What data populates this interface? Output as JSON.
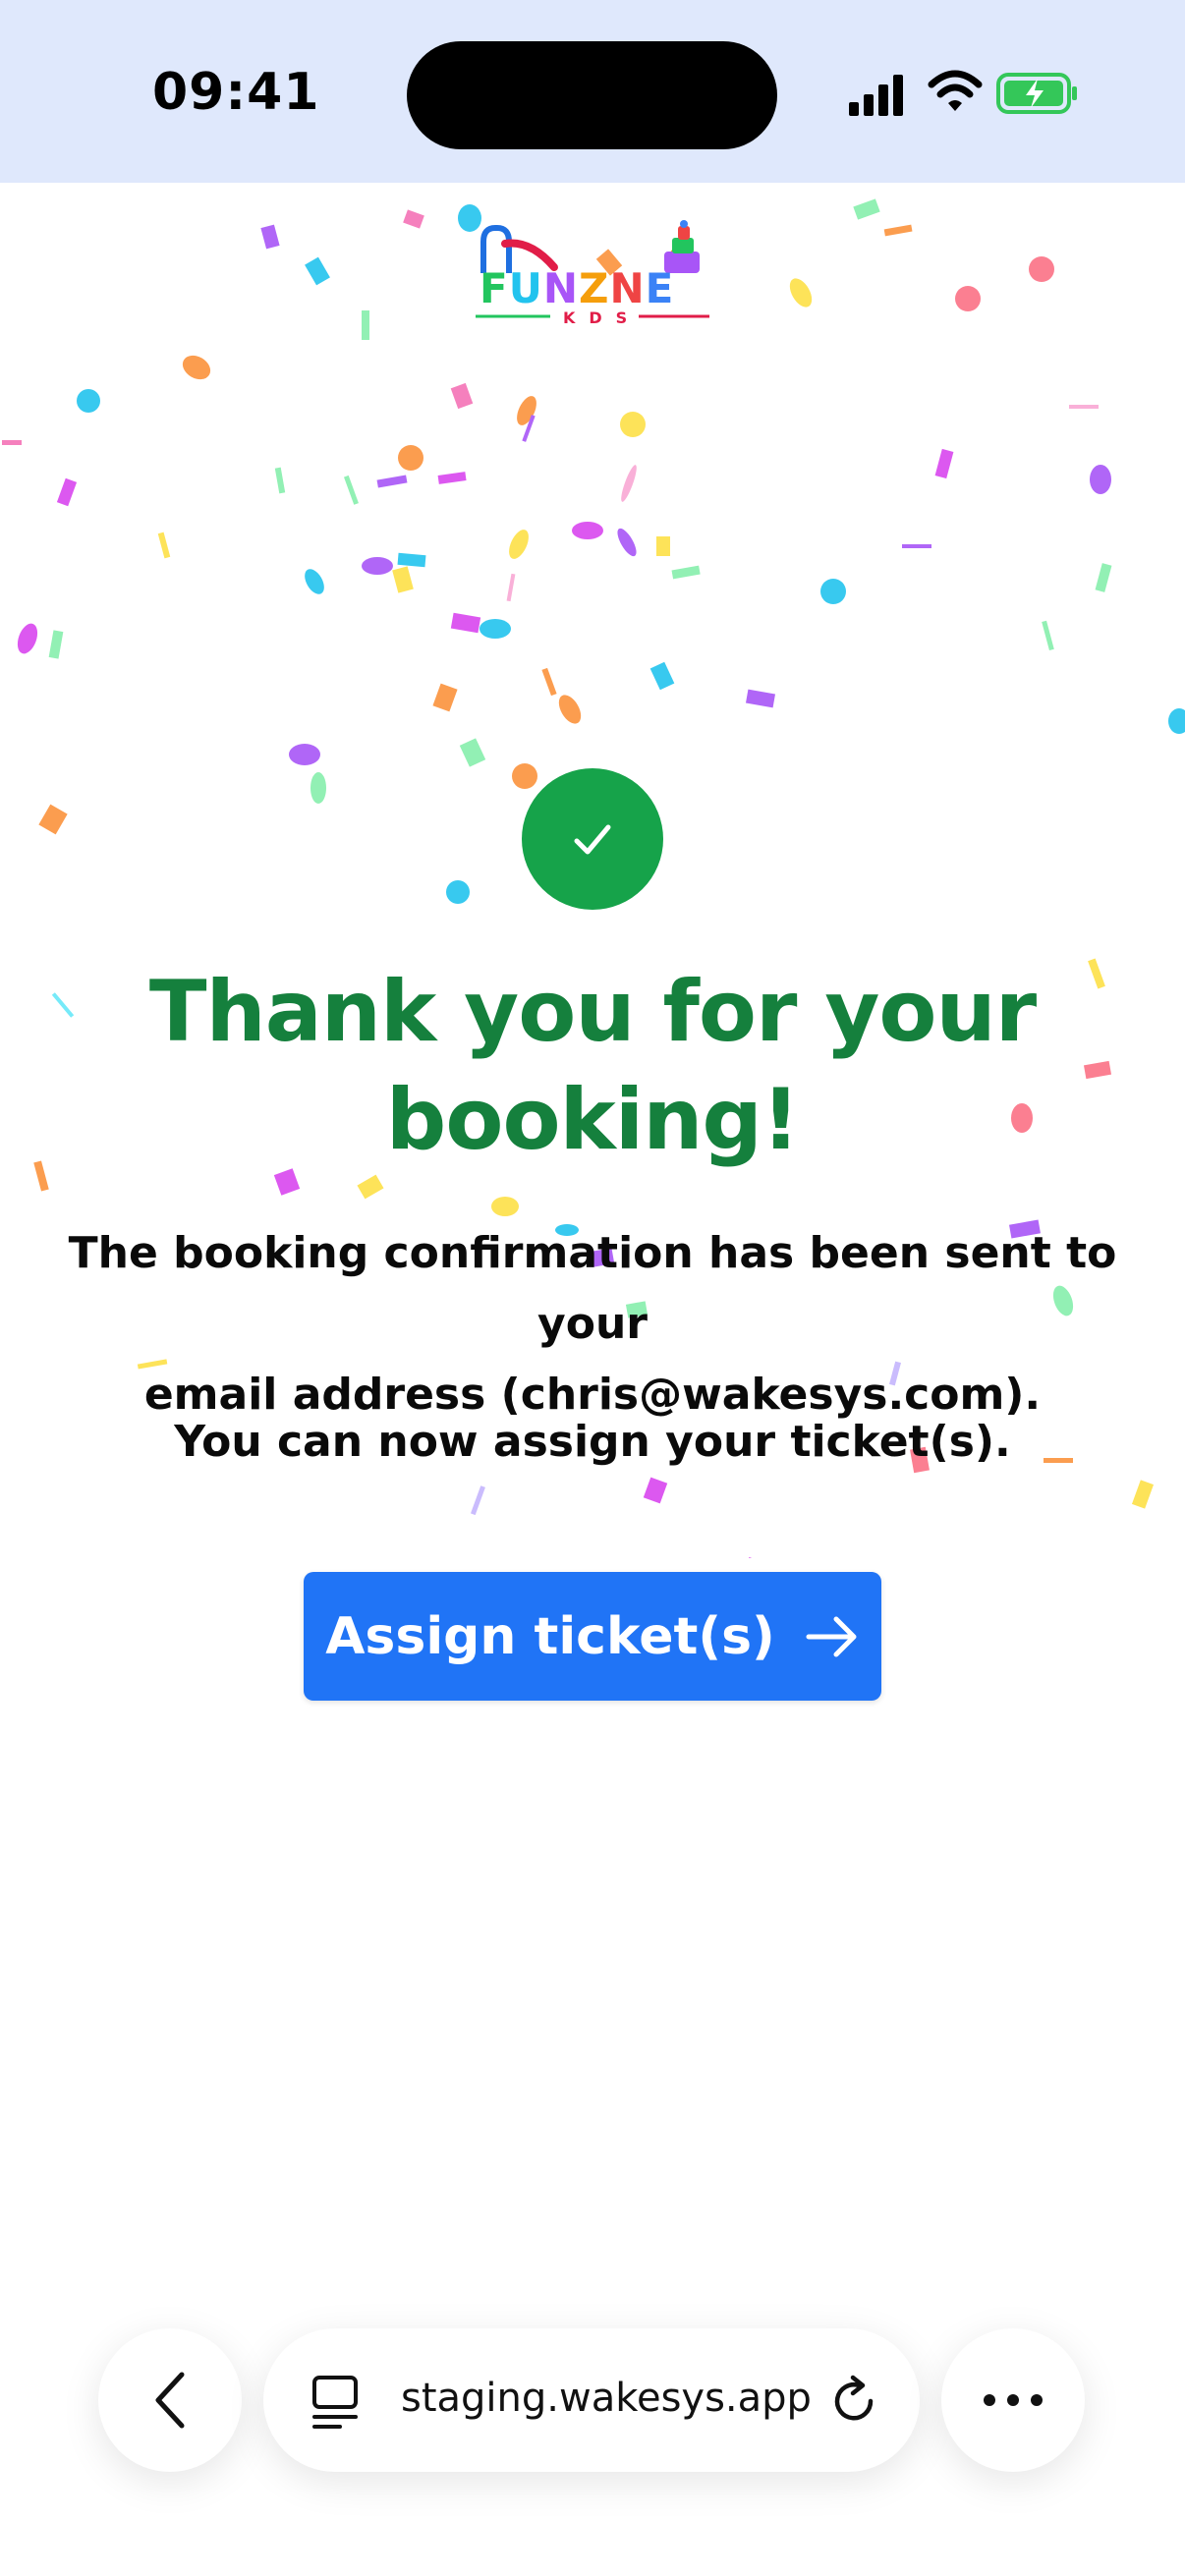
{
  "status_bar": {
    "time": "09:41"
  },
  "logo": {
    "brand": "FUNZNE",
    "sub": "KIDS"
  },
  "main": {
    "heading_line1": "Thank you for your",
    "heading_line2": "booking!",
    "confirmation_line1": "The booking confirmation has been sent to your",
    "confirmation_line2": "email address (chris@wakesys.com).",
    "assign_prompt": "You can now assign your ticket(s).",
    "assign_button_label": "Assign ticket(s)"
  },
  "browser": {
    "url": "staging.wakesys.app"
  },
  "colors": {
    "status_bar_bg": "#dfe8fc",
    "heading_green": "#15803d",
    "check_green": "#16a34a",
    "button_blue": "#2074f6",
    "battery_green": "#34c759"
  },
  "icons": [
    "signal-icon",
    "wifi-icon",
    "battery-icon",
    "check-icon",
    "arrow-right-icon",
    "back-icon",
    "tabs-icon",
    "reload-icon",
    "more-icon"
  ]
}
